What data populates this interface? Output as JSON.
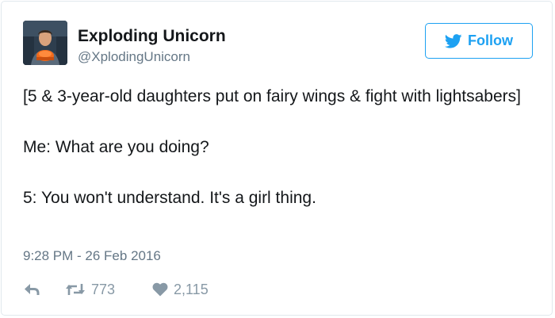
{
  "author": {
    "display_name": "Exploding Unicorn",
    "handle": "@XplodingUnicorn"
  },
  "follow_button": {
    "label": "Follow",
    "color": "#1da1f2"
  },
  "tweet": {
    "text": "[5 & 3-year-old daughters put on fairy wings & fight with lightsabers]\n\nMe: What are you doing?\n\n5: You won't understand. It's a girl thing.",
    "timestamp": "9:28 PM - 26 Feb 2016"
  },
  "actions": {
    "reply_icon": "reply-icon",
    "retweet_icon": "retweet-icon",
    "retweet_count": "773",
    "like_icon": "heart-icon",
    "like_count": "2,115"
  },
  "colors": {
    "text": "#14171a",
    "secondary": "#657786",
    "action_gray": "#8899a6",
    "border": "#e1e8ed"
  }
}
